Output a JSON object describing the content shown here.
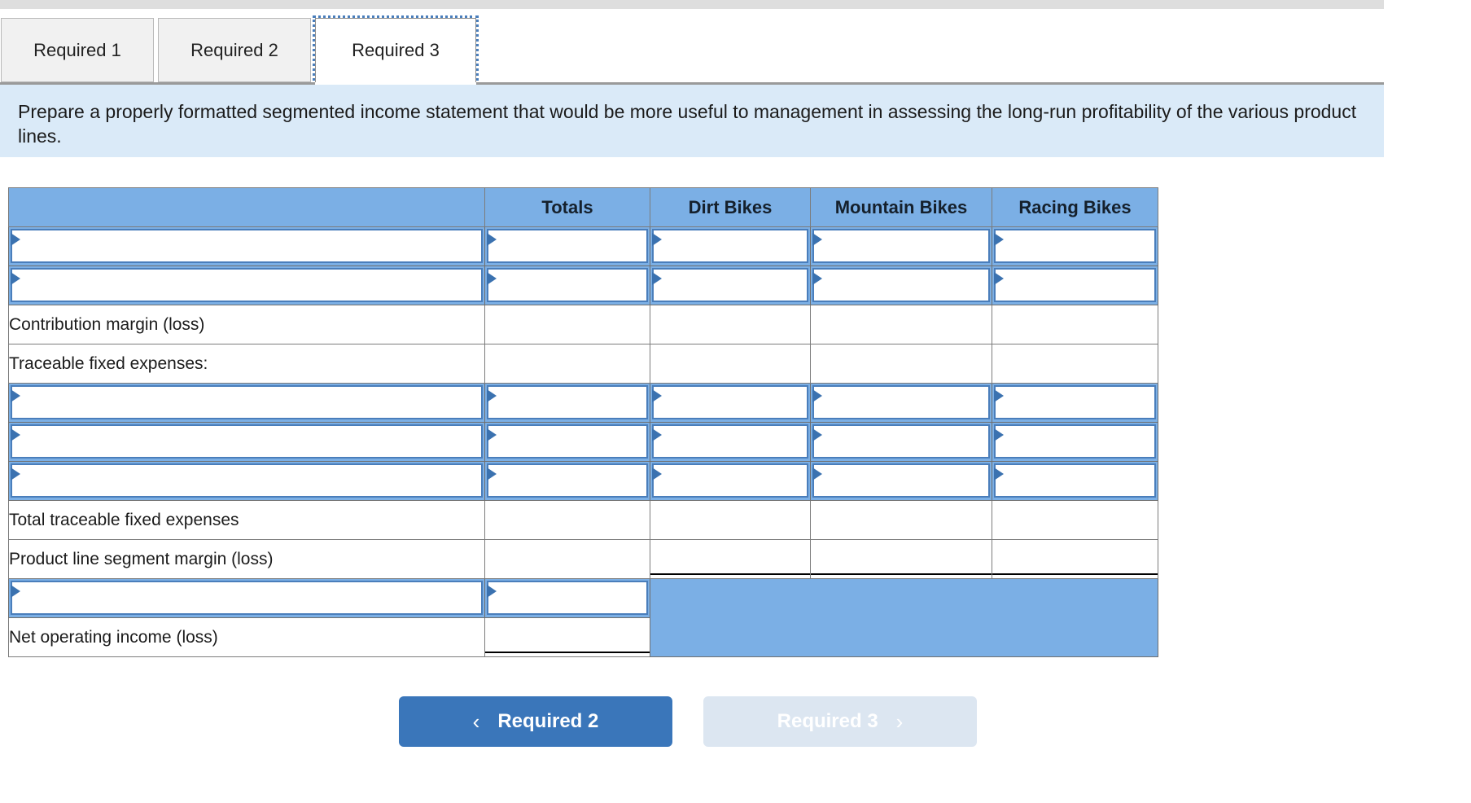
{
  "tabs": [
    {
      "label": "Required 1",
      "active": false
    },
    {
      "label": "Required 2",
      "active": false
    },
    {
      "label": "Required 3",
      "active": true
    }
  ],
  "instruction": "Prepare a properly formatted segmented income statement that would be more useful to management in assessing the long-run profitability of the various product lines.",
  "table": {
    "columns": [
      "",
      "Totals",
      "Dirt Bikes",
      "Mountain Bikes",
      "Racing Bikes"
    ],
    "rows": [
      {
        "type": "input",
        "label": "",
        "cells": 4
      },
      {
        "type": "input",
        "label": "",
        "cells": 4
      },
      {
        "type": "label",
        "label": "Contribution margin (loss)",
        "cells": 4
      },
      {
        "type": "label",
        "label": "Traceable fixed expenses:",
        "cells": 4
      },
      {
        "type": "input",
        "label": "",
        "cells": 4
      },
      {
        "type": "input",
        "label": "",
        "cells": 4
      },
      {
        "type": "input",
        "label": "",
        "cells": 4
      },
      {
        "type": "label",
        "label": "Total traceable fixed expenses",
        "cells": 4
      },
      {
        "type": "label",
        "label": "Product line segment margin (loss)",
        "cells": 4
      },
      {
        "type": "input",
        "label": "",
        "cells": 1
      },
      {
        "type": "label",
        "label": "Net operating income (loss)",
        "cells": 1
      }
    ]
  },
  "nav": {
    "prev": {
      "label": "Required 2",
      "icon": "chevron-left-icon",
      "glyph": "‹",
      "enabled": true
    },
    "next": {
      "label": "Required 3",
      "icon": "chevron-right-icon",
      "glyph": "›",
      "enabled": false
    }
  },
  "colors": {
    "header_blue": "#7bafe5",
    "banner_blue": "#daeaf8",
    "input_border": "#4a7ebb",
    "button_active": "#3a76ba",
    "button_disabled": "#dce6f1"
  }
}
